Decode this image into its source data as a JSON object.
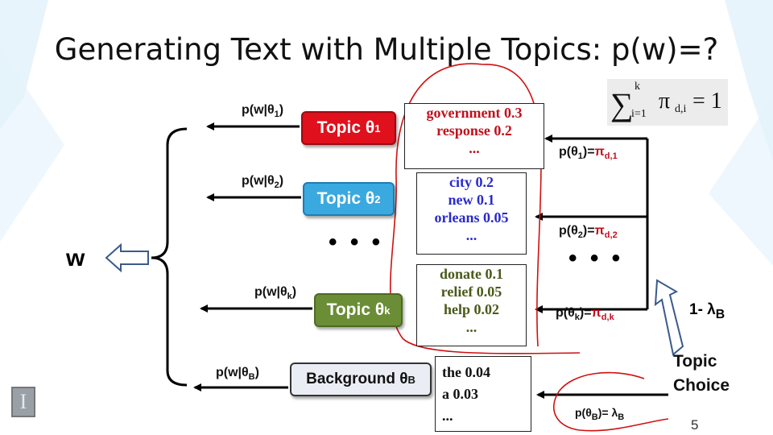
{
  "slide": {
    "title": "Generating Text with Multiple Topics: p(w)=?",
    "page_number": "5"
  },
  "formula": {
    "sigma": "∑",
    "upper": "k",
    "lower": "i=1",
    "pi": "π",
    "sub": "d,i",
    "equals": "= 1"
  },
  "topics": [
    {
      "name": "Topic θ",
      "sub": "1",
      "prob_label": "p(w|θ",
      "prob_sub": "1",
      "words": [
        "government 0.3",
        "response  0.2",
        "..."
      ],
      "mix_lhs": "p(θ",
      "mix_sub": "1",
      "mix_rhs": ")=",
      "mix_pi": "π",
      "mix_pi_sub": "d,1"
    },
    {
      "name": "Topic θ",
      "sub": "2",
      "prob_label": "p(w|θ",
      "prob_sub": "2",
      "words": [
        "city 0.2",
        "new   0.1",
        "orleans 0.05",
        "..."
      ],
      "mix_lhs": "p(θ",
      "mix_sub": "2",
      "mix_rhs": ")=",
      "mix_pi": "π",
      "mix_pi_sub": "d,2"
    },
    {
      "name": "Topic θ",
      "sub": "k",
      "prob_label": "p(w|θ",
      "prob_sub": "k",
      "words": [
        "donate  0.1",
        "relief 0.05",
        "help 0.02",
        "..."
      ],
      "mix_lhs": "p(θ",
      "mix_sub": "k",
      "mix_rhs": ")=",
      "mix_pi": "π",
      "mix_pi_sub": "d,k"
    }
  ],
  "background": {
    "name": "Background θ",
    "sub": "B",
    "prob_label": "p(w|θ",
    "prob_sub": "B",
    "words": [
      "the  0.04",
      "a 0.03",
      "..."
    ],
    "mix_label": "p(θ",
    "mix_sub": "B",
    "mix_rhs": ")= λ",
    "mix_lambda_sub": "B"
  },
  "labels": {
    "w": "w",
    "dots": "• • •",
    "one_minus_lambda": "1- λ",
    "one_minus_lambda_sub": "B",
    "topic_choice_line1": "Topic",
    "topic_choice_line2": "Choice"
  },
  "colors": {
    "topic1": "#e0101c",
    "topic2": "#3aa9e0",
    "topick": "#6a8d36",
    "annotation": "#d01010"
  }
}
